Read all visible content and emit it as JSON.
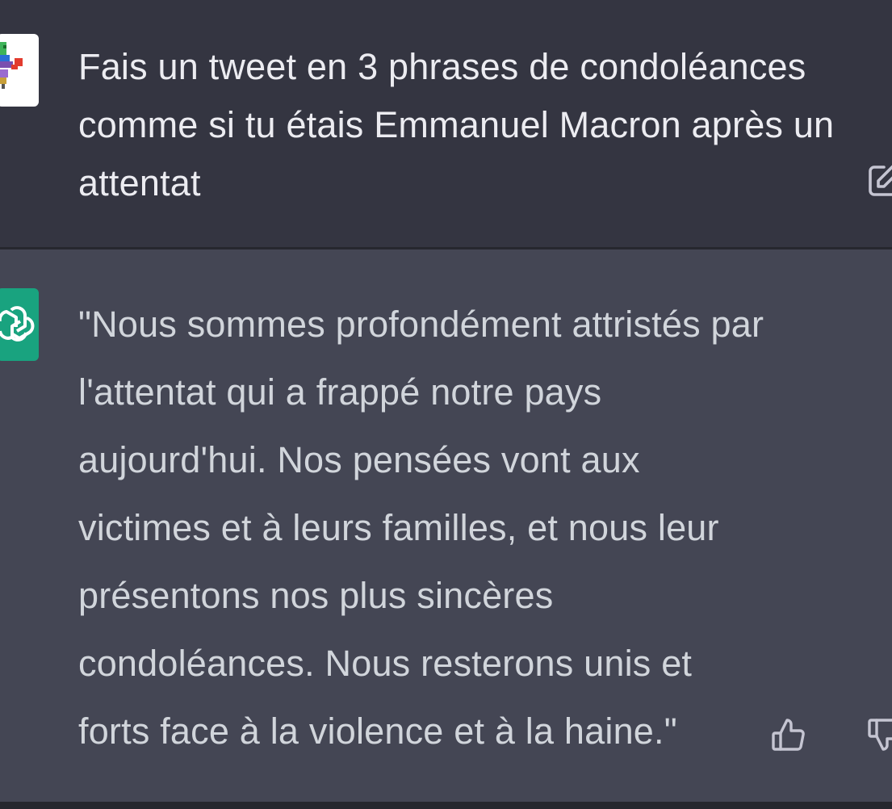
{
  "conversation": {
    "user_message": {
      "avatar_icon": "pixel-art-user-avatar-icon",
      "text": "Fais un tweet en 3 phrases de condoléances comme si tu étais Emmanuel Macron après un attentat",
      "action_icon": "edit-icon"
    },
    "assistant_message": {
      "avatar_icon": "openai-logo-icon",
      "text": "\"Nous sommes profondément attristés par l'attentat qui a frappé notre pays aujourd'hui. Nos pensées vont aux victimes et à leurs familles, et nous leur présentons nos plus sincères condoléances. Nous resterons unis et forts face à la violence et à la haine.\"",
      "feedback_icons": [
        "thumbs-up-icon",
        "thumbs-down-icon"
      ]
    }
  },
  "colors": {
    "user_bg": "#343541",
    "assistant_bg": "#444654",
    "text": "#ececf1",
    "assistant_text": "#d1d5db",
    "gpt_avatar": "#19a37f"
  }
}
